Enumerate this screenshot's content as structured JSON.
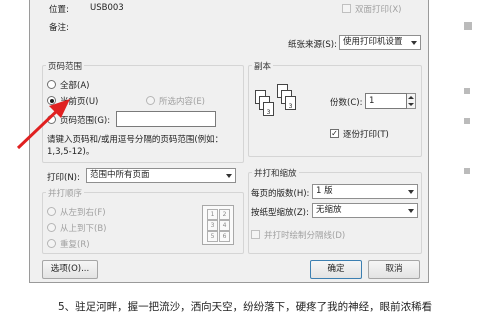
{
  "top": {
    "location_label": "位置:",
    "location_value": "USB003",
    "comment_label": "备注:",
    "duplex_label": "双面打印(X)",
    "paper_source_label": "纸张来源(S):",
    "paper_source_value": "使用打印机设置"
  },
  "page_range": {
    "title": "页码范围",
    "all": "全部(A)",
    "current": "当前页(U)",
    "selection": "所选内容(E)",
    "pages": "页码范围(G):",
    "hint_line1": "请键入页码和/或用逗号分隔的页码范围(例如：",
    "hint_line2": "1,3,5-12)。"
  },
  "copies": {
    "title": "副本",
    "count_label": "份数(C):",
    "count_value": "1",
    "collate_label": "逐份打印(T)",
    "page_numbers": [
      "1",
      "2",
      "3",
      "1",
      "2",
      "3"
    ]
  },
  "print_what": {
    "label": "打印(N):",
    "value": "范围中所有页面"
  },
  "order": {
    "title": "并打顺序",
    "left_to_right": "从左到右(F)",
    "top_to_bottom": "从上到下(B)",
    "repeat": "重复(R)",
    "preview_numbers": [
      "1",
      "2",
      "3",
      "4",
      "5",
      "6"
    ]
  },
  "zoom": {
    "title": "并打和缩放",
    "pages_per_sheet_label": "每页的版数(H):",
    "pages_per_sheet_value": "1 版",
    "scale_label": "按纸型缩放(Z):",
    "scale_value": "无缩放",
    "draw_borders_label": "并打时绘制分隔线(D)"
  },
  "buttons": {
    "options": "选项(O)...",
    "ok": "确定",
    "cancel": "取消"
  },
  "caption": "5、驻足河畔，握一把流沙，洒向天空，纷纷落下，硬疼了我的神经，眼前浓稀看"
}
